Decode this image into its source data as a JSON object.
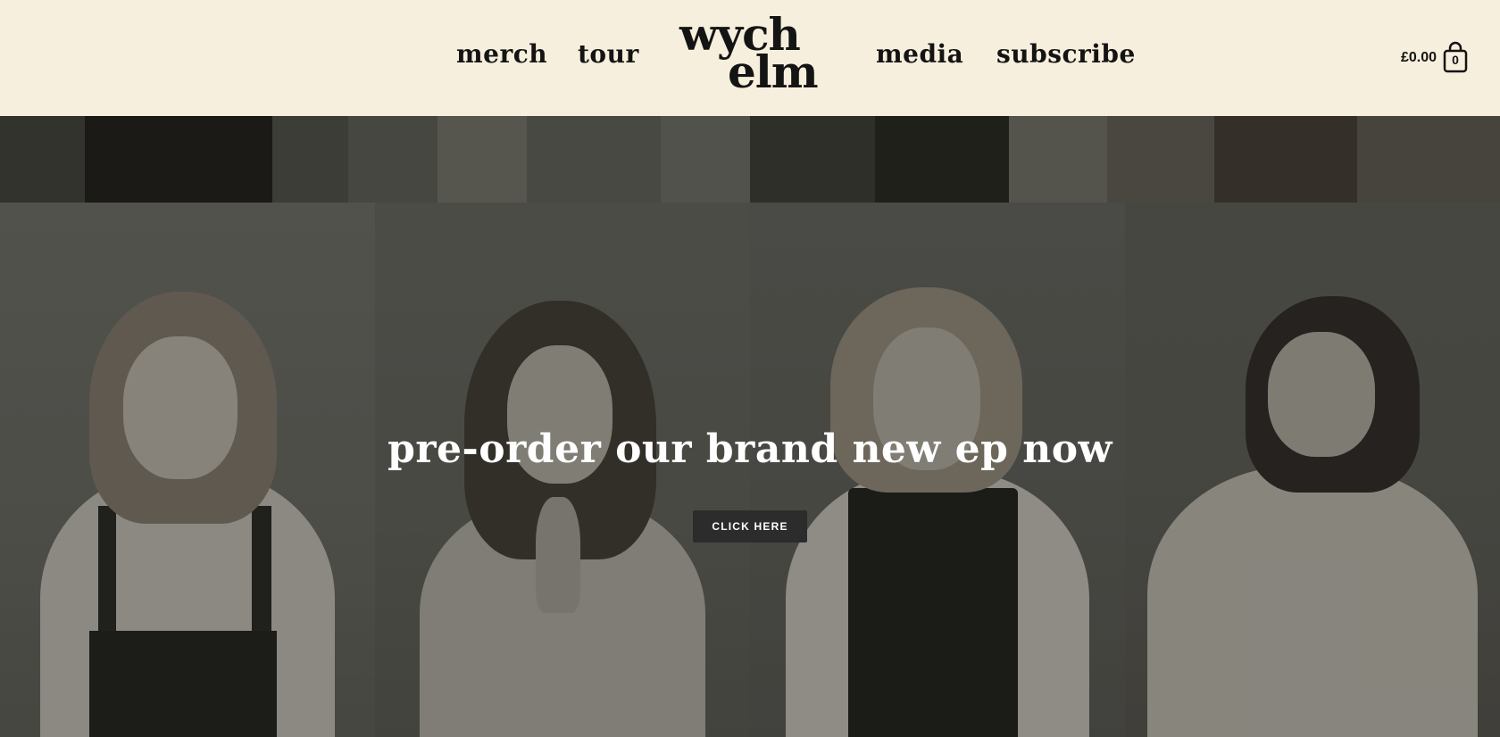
{
  "header": {
    "nav_left": [
      {
        "label": "merch"
      },
      {
        "label": "tour"
      }
    ],
    "logo": {
      "line1": "wych",
      "line2": "elm"
    },
    "nav_right": [
      {
        "label": "media"
      },
      {
        "label": "subscribe"
      }
    ],
    "cart": {
      "total": "£0.00",
      "count": "0",
      "icon": "shopping-bag-icon"
    }
  },
  "hero": {
    "headline": "pre-order our brand new ep now",
    "cta_label": "CLICK HERE"
  },
  "colors": {
    "header_bg": "#f7efdd",
    "text_dark": "#141414",
    "button_bg": "#2c2c2c",
    "headline_text": "#ffffff"
  }
}
